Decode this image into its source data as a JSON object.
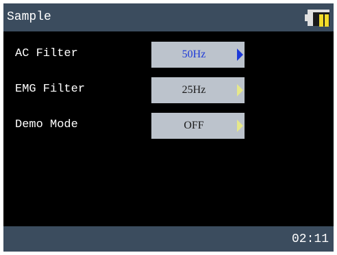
{
  "header": {
    "title": "Sample"
  },
  "battery": {
    "icon": "battery-icon",
    "level_fraction": 0.4,
    "fill_color": "#f2dc2a"
  },
  "settings": [
    {
      "label": "AC Filter",
      "value": "50Hz",
      "selected": true
    },
    {
      "label": "EMG Filter",
      "value": "25Hz",
      "selected": false
    },
    {
      "label": "Demo Mode",
      "value": "OFF",
      "selected": false
    }
  ],
  "status": {
    "time": "02:11"
  },
  "colors": {
    "bar": "#3b4c5e",
    "value_box": "#bcc3cc",
    "selected_text": "#1d39d8",
    "arrow_inactive": "#e6e88a"
  }
}
